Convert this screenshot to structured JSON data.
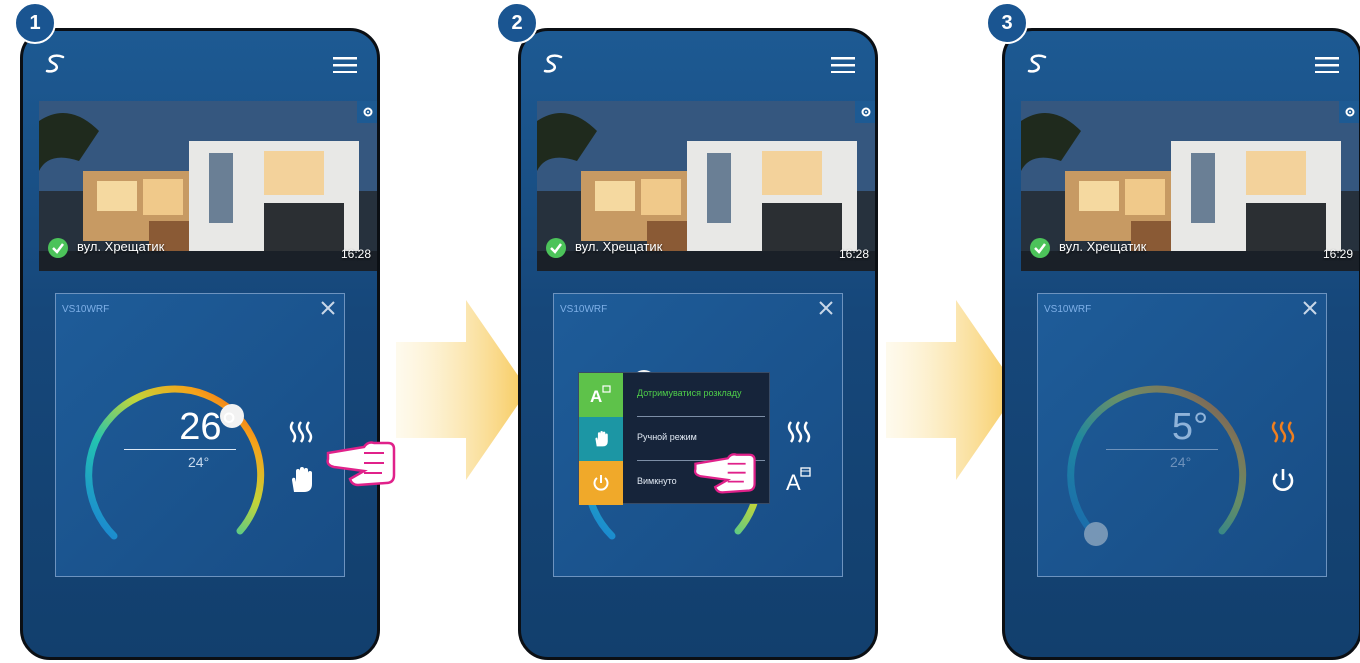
{
  "steps": [
    {
      "number": "1",
      "address": "вул. Хрещатик",
      "time": "16:28",
      "device": "VS10WRF",
      "temperature": "26°",
      "setpoint": "24°",
      "mode_icon": "hand-icon",
      "heating_color": "#ffffff"
    },
    {
      "number": "2",
      "address": "вул. Хрещатик",
      "time": "16:28",
      "device": "VS10WRF",
      "mode_icon": "auto-schedule-icon",
      "menu": [
        {
          "label": "Дотримуватися розкладу",
          "color": "#5ec24a",
          "icon": "auto-schedule-icon",
          "text_color": "#4fcf4a"
        },
        {
          "label": "Ручной режим",
          "color": "#1c96a4",
          "icon": "hand-icon",
          "text_color": "#e3ebf5"
        },
        {
          "label": "Вимкнуто",
          "color": "#f0a92a",
          "icon": "power-icon",
          "text_color": "#e3ebf5"
        }
      ]
    },
    {
      "number": "3",
      "address": "вул. Хрещатик",
      "time": "16:29",
      "device": "VS10WRF",
      "temperature": "5°",
      "setpoint": "24°",
      "mode_icon": "power-icon",
      "heating_color": "#f07f1f"
    }
  ],
  "colors": {
    "phone_bg": "#1d5a93",
    "badge": "#1a5591",
    "arrow": "#f7d36e",
    "finger": "#e0218a",
    "check": "#4cc35a"
  }
}
